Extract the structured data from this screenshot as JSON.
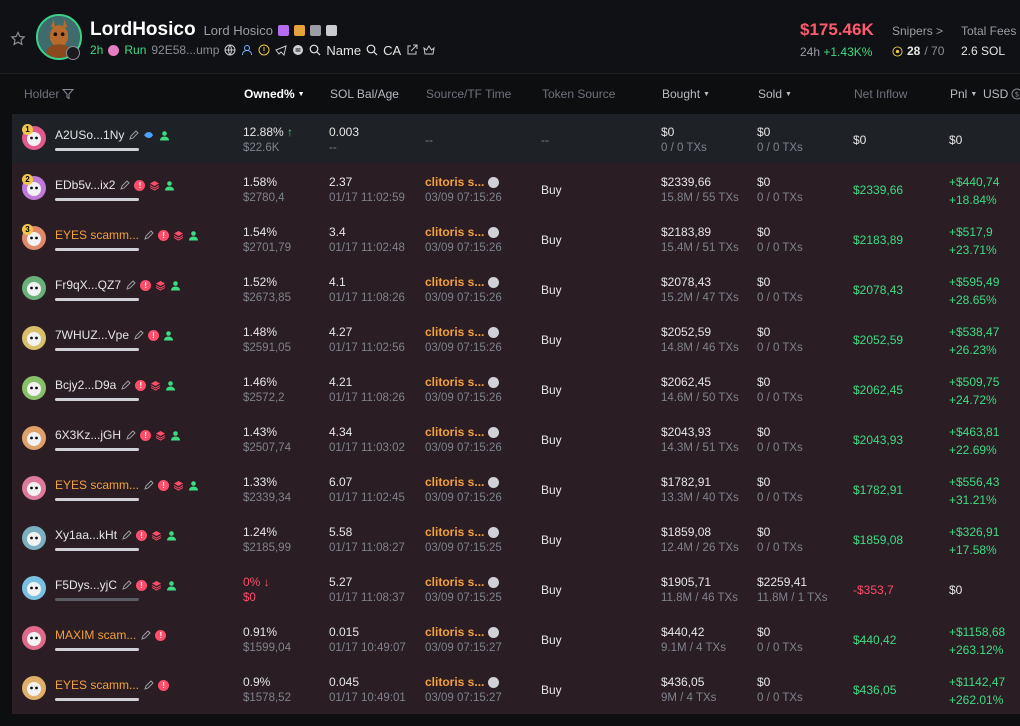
{
  "header": {
    "name": "LordHosico",
    "subname": "Lord Hosico",
    "age": "2h",
    "run_label": "Run",
    "address": "92E58...ump",
    "name_search": "Name",
    "ca_search": "CA",
    "price": "$175.46K",
    "change_period": "24h",
    "change": "+1.43K%",
    "snipers_label": "Snipers >",
    "snipers_value": "28",
    "snipers_total": "/ 70",
    "fees_label": "Total Fees",
    "fees_value": "2.6 SOL"
  },
  "columns": {
    "holder": "Holder",
    "owned": "Owned%",
    "sol": "SOL Bal/Age",
    "source_time": "Source/TF Time",
    "token_source": "Token Source",
    "bought": "Bought",
    "sold": "Sold",
    "net_inflow": "Net Inflow",
    "pnl": "Pnl",
    "usd": "USD"
  },
  "rows": [
    {
      "rank": "1",
      "name": "A2USo...1Ny",
      "name_color": "white",
      "owned_pct": "12.88%",
      "owned_usd": "$22.6K",
      "sol": "0.003",
      "age": "--",
      "source": "--",
      "source_time": "",
      "token_source": "--",
      "bought": "$0",
      "bought_txs": "0 / 0 TXs",
      "sold": "$0",
      "sold_txs": "0 / 0 TXs",
      "inflow": "$0",
      "pnl1": "$0",
      "pnl2": ""
    },
    {
      "rank": "2",
      "name": "EDb5v...ix2",
      "name_color": "white",
      "owned_pct": "1.58%",
      "owned_usd": "$2780,4",
      "sol": "2.37",
      "age": "01/17 11:02:59",
      "source": "clitoris s...",
      "source_time": "03/09 07:15:26",
      "token_source": "Buy",
      "bought": "$2339,66",
      "bought_txs": "15.8M / 55 TXs",
      "sold": "$0",
      "sold_txs": "0 / 0 TXs",
      "inflow": "$2339,66",
      "pnl1": "+$440,74",
      "pnl2": "+18.84%"
    },
    {
      "rank": "3",
      "name": "EYES scamm...",
      "name_color": "orange",
      "owned_pct": "1.54%",
      "owned_usd": "$2701,79",
      "sol": "3.4",
      "age": "01/17 11:02:48",
      "source": "clitoris s...",
      "source_time": "03/09 07:15:26",
      "token_source": "Buy",
      "bought": "$2183,89",
      "bought_txs": "15.4M / 51 TXs",
      "sold": "$0",
      "sold_txs": "0 / 0 TXs",
      "inflow": "$2183,89",
      "pnl1": "+$517,9",
      "pnl2": "+23.71%"
    },
    {
      "rank": "",
      "name": "Fr9qX...QZ7",
      "name_color": "white",
      "owned_pct": "1.52%",
      "owned_usd": "$2673,85",
      "sol": "4.1",
      "age": "01/17 11:08:26",
      "source": "clitoris s...",
      "source_time": "03/09 07:15:26",
      "token_source": "Buy",
      "bought": "$2078,43",
      "bought_txs": "15.2M / 47 TXs",
      "sold": "$0",
      "sold_txs": "0 / 0 TXs",
      "inflow": "$2078,43",
      "pnl1": "+$595,49",
      "pnl2": "+28.65%"
    },
    {
      "rank": "",
      "name": "7WHUZ...Vpe",
      "name_color": "white",
      "owned_pct": "1.48%",
      "owned_usd": "$2591,05",
      "sol": "4.27",
      "age": "01/17 11:02:56",
      "source": "clitoris s...",
      "source_time": "03/09 07:15:26",
      "token_source": "Buy",
      "bought": "$2052,59",
      "bought_txs": "14.8M / 46 TXs",
      "sold": "$0",
      "sold_txs": "0 / 0 TXs",
      "inflow": "$2052,59",
      "pnl1": "+$538,47",
      "pnl2": "+26.23%"
    },
    {
      "rank": "",
      "name": "Bcjy2...D9a",
      "name_color": "white",
      "owned_pct": "1.46%",
      "owned_usd": "$2572,2",
      "sol": "4.21",
      "age": "01/17 11:08:26",
      "source": "clitoris s...",
      "source_time": "03/09 07:15:26",
      "token_source": "Buy",
      "bought": "$2062,45",
      "bought_txs": "14.6M / 50 TXs",
      "sold": "$0",
      "sold_txs": "0 / 0 TXs",
      "inflow": "$2062,45",
      "pnl1": "+$509,75",
      "pnl2": "+24.72%"
    },
    {
      "rank": "",
      "name": "6X3Kz...jGH",
      "name_color": "white",
      "owned_pct": "1.43%",
      "owned_usd": "$2507,74",
      "sol": "4.34",
      "age": "01/17 11:03:02",
      "source": "clitoris s...",
      "source_time": "03/09 07:15:26",
      "token_source": "Buy",
      "bought": "$2043,93",
      "bought_txs": "14.3M / 51 TXs",
      "sold": "$0",
      "sold_txs": "0 / 0 TXs",
      "inflow": "$2043,93",
      "pnl1": "+$463,81",
      "pnl2": "+22.69%"
    },
    {
      "rank": "",
      "name": "EYES scamm...",
      "name_color": "orange",
      "owned_pct": "1.33%",
      "owned_usd": "$2339,34",
      "sol": "6.07",
      "age": "01/17 11:02:45",
      "source": "clitoris s...",
      "source_time": "03/09 07:15:26",
      "token_source": "Buy",
      "bought": "$1782,91",
      "bought_txs": "13.3M / 40 TXs",
      "sold": "$0",
      "sold_txs": "0 / 0 TXs",
      "inflow": "$1782,91",
      "pnl1": "+$556,43",
      "pnl2": "+31.21%"
    },
    {
      "rank": "",
      "name": "Xy1aa...kHt",
      "name_color": "white",
      "owned_pct": "1.24%",
      "owned_usd": "$2185,99",
      "sol": "5.58",
      "age": "01/17 11:08:27",
      "source": "clitoris s...",
      "source_time": "03/09 07:15:25",
      "token_source": "Buy",
      "bought": "$1859,08",
      "bought_txs": "12.4M / 26 TXs",
      "sold": "$0",
      "sold_txs": "0 / 0 TXs",
      "inflow": "$1859,08",
      "pnl1": "+$326,91",
      "pnl2": "+17.58%"
    },
    {
      "rank": "",
      "name": "F5Dys...yjC",
      "name_color": "white",
      "owned_pct": "0%",
      "owned_usd": "$0",
      "sol": "5.27",
      "age": "01/17 11:08:37",
      "source": "clitoris s...",
      "source_time": "03/09 07:15:25",
      "token_source": "Buy",
      "bought": "$1905,71",
      "bought_txs": "11.8M / 46 TXs",
      "sold": "$2259,41",
      "sold_txs": "11.8M / 1 TXs",
      "inflow": "-$353,7",
      "pnl1": "$0",
      "pnl2": ""
    },
    {
      "rank": "",
      "name": "MAXIM scam...",
      "name_color": "orange",
      "owned_pct": "0.91%",
      "owned_usd": "$1599,04",
      "sol": "0.015",
      "age": "01/17 10:49:07",
      "source": "clitoris s...",
      "source_time": "03/09 07:15:27",
      "token_source": "Buy",
      "bought": "$440,42",
      "bought_txs": "9.1M / 4 TXs",
      "sold": "$0",
      "sold_txs": "0 / 0 TXs",
      "inflow": "$440,42",
      "pnl1": "+$1158,68",
      "pnl2": "+263.12%"
    },
    {
      "rank": "",
      "name": "EYES scamm...",
      "name_color": "orange",
      "owned_pct": "0.9%",
      "owned_usd": "$1578,52",
      "sol": "0.045",
      "age": "01/17 10:49:01",
      "source": "clitoris s...",
      "source_time": "03/09 07:15:27",
      "token_source": "Buy",
      "bought": "$436,05",
      "bought_txs": "9M / 4 TXs",
      "sold": "$0",
      "sold_txs": "0 / 0 TXs",
      "inflow": "$436,05",
      "pnl1": "+$1142,47",
      "pnl2": "+262.01%"
    }
  ],
  "colors": {
    "green": "#3ddc84",
    "red": "#ff4d6a",
    "orange": "#f3a13c",
    "row_bg": "#2a1d24"
  }
}
